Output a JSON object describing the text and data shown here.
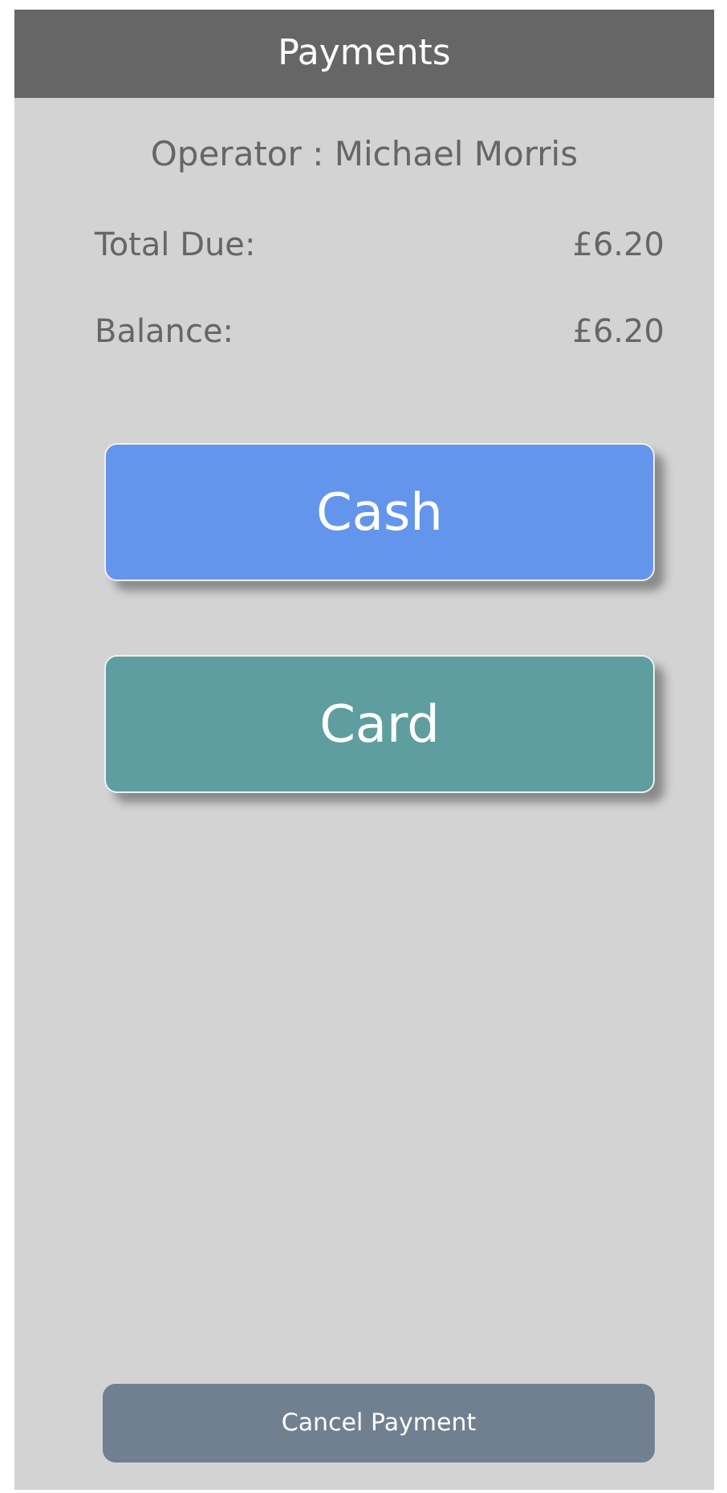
{
  "header": {
    "title": "Payments"
  },
  "operator": "Operator : Michael Morris",
  "totals": [
    {
      "label": "Total Due:",
      "value": "£6.20"
    },
    {
      "label": "Balance:",
      "value": "£6.20"
    }
  ],
  "payment_methods": [
    {
      "label": "Cash",
      "color": "#6495ed"
    },
    {
      "label": "Card",
      "color": "#5f9ea0"
    }
  ],
  "cancel_button": "Cancel Payment"
}
